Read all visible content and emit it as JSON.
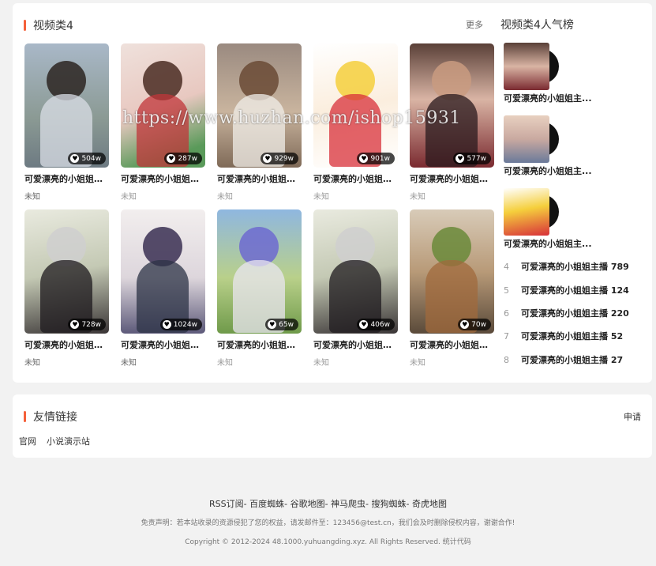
{
  "main_section": {
    "title": "视频类4",
    "more": "更多"
  },
  "rank_section": {
    "title": "视频类4人气榜"
  },
  "videos": [
    {
      "title": "可爱漂亮的小姐姐主播",
      "likes": "504w",
      "sub": "未知"
    },
    {
      "title": "可爱漂亮的小姐姐主播",
      "likes": "287w",
      "sub": "未知"
    },
    {
      "title": "可爱漂亮的小姐姐主播",
      "likes": "929w",
      "sub": "未知"
    },
    {
      "title": "可爱漂亮的小姐姐主播",
      "likes": "901w",
      "sub": "未知"
    },
    {
      "title": "可爱漂亮的小姐姐主播",
      "likes": "577w",
      "sub": "未知"
    },
    {
      "title": "可爱漂亮的小姐姐主播",
      "likes": "728w",
      "sub": "未知"
    },
    {
      "title": "可爱漂亮的小姐姐主播",
      "likes": "1024w",
      "sub": "未知"
    },
    {
      "title": "可爱漂亮的小姐姐主播",
      "likes": "65w",
      "sub": "未知"
    },
    {
      "title": "可爱漂亮的小姐姐主播",
      "likes": "406w",
      "sub": "未知"
    },
    {
      "title": "可爱漂亮的小姐姐主播",
      "likes": "70w",
      "sub": "未知"
    }
  ],
  "rank_top": [
    {
      "title": "可爱漂亮的小姐姐主..."
    },
    {
      "title": "可爱漂亮的小姐姐主..."
    },
    {
      "title": "可爱漂亮的小姐姐主..."
    }
  ],
  "rank_list": [
    {
      "num": "4",
      "title": "可爱漂亮的小姐姐主播 789"
    },
    {
      "num": "5",
      "title": "可爱漂亮的小姐姐主播 124"
    },
    {
      "num": "6",
      "title": "可爱漂亮的小姐姐主播 220"
    },
    {
      "num": "7",
      "title": "可爱漂亮的小姐姐主播 52"
    },
    {
      "num": "8",
      "title": "可爱漂亮的小姐姐主播 27"
    }
  ],
  "watermark": "https://www.huzhan.com/ishop15931",
  "links_section": {
    "title": "友情链接",
    "apply": "申请"
  },
  "friend_links": [
    "官网",
    "小说演示站"
  ],
  "footer": {
    "nav": "RSS订阅- 百度蜘蛛- 谷歌地图- 神马爬虫- 搜狗蜘蛛- 奇虎地图",
    "disclaimer": "免责声明：若本站收录的资源侵犯了您的权益，请发邮件至：123456@test.cn，我们会及时删除侵权内容，谢谢合作!",
    "copyright": "Copyright © 2012-2024 48.1000.yuhuangding.xyz. All Rights Reserved. 统计代码"
  },
  "colors": {
    "accent": "#f5603a",
    "background": "#f2f2f2",
    "card": "#ffffff"
  },
  "icons": {
    "likes": "heart-icon"
  }
}
